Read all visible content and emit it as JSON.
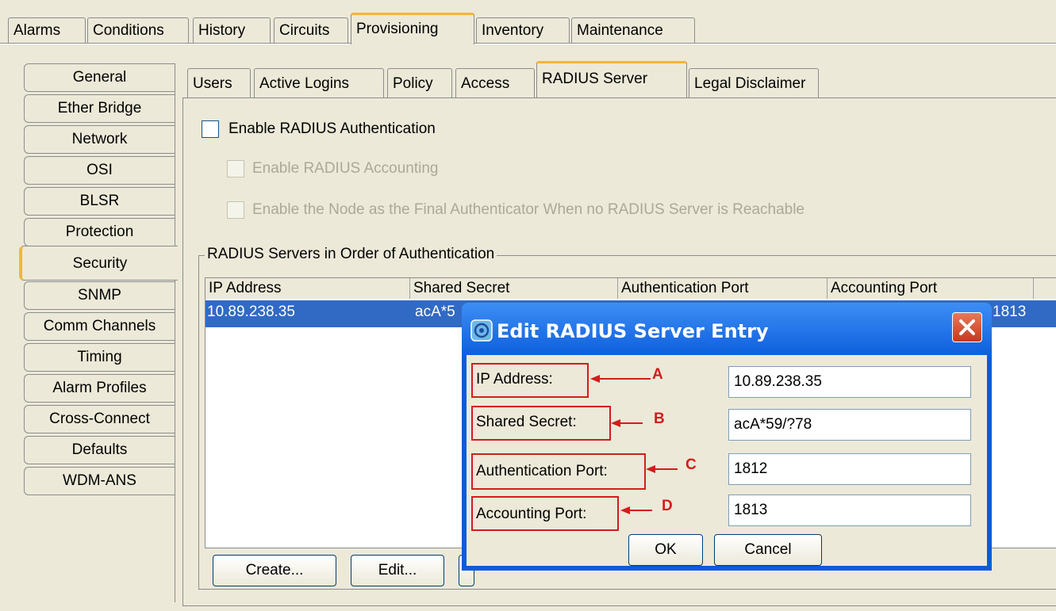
{
  "top_tabs": [
    "Alarms",
    "Conditions",
    "History",
    "Circuits",
    "Provisioning",
    "Inventory",
    "Maintenance"
  ],
  "top_tabs_active": "Provisioning",
  "sidebar": {
    "items": [
      "General",
      "Ether Bridge",
      "Network",
      "OSI",
      "BLSR",
      "Protection",
      "Security",
      "SNMP",
      "Comm Channels",
      "Timing",
      "Alarm Profiles",
      "Cross-Connect",
      "Defaults",
      "WDM-ANS"
    ],
    "active": "Security"
  },
  "sub_tabs": [
    "Users",
    "Active Logins",
    "Policy",
    "Access",
    "RADIUS Server",
    "Legal Disclaimer"
  ],
  "sub_tabs_active": "RADIUS Server",
  "options": {
    "enable_radius_auth": "Enable RADIUS Authentication",
    "enable_radius_accounting": "Enable RADIUS Accounting",
    "enable_final_authenticator": "Enable the Node as the Final Authenticator When no RADIUS Server is Reachable"
  },
  "servers_group": {
    "title": "RADIUS Servers in Order of Authentication",
    "columns": [
      "IP Address",
      "Shared Secret",
      "Authentication Port",
      "Accounting Port"
    ],
    "rows": [
      {
        "ip": "10.89.238.35",
        "secret": "acA*5",
        "auth_port": "",
        "acct_port": "1813"
      }
    ]
  },
  "buttons": {
    "create": "Create...",
    "edit": "Edit..."
  },
  "dialog": {
    "title": "Edit RADIUS Server Entry",
    "fields": [
      {
        "label": "IP Address:",
        "value": "10.89.238.35",
        "marker": "A"
      },
      {
        "label": "Shared Secret:",
        "value": "acA*59/?78",
        "marker": "B"
      },
      {
        "label": "Authentication Port:",
        "value": "1812",
        "marker": "C"
      },
      {
        "label": "Accounting Port:",
        "value": "1813",
        "marker": "D"
      }
    ],
    "ok": "OK",
    "cancel": "Cancel",
    "annotation_color": "#d41c1c"
  },
  "colors": {
    "accent_tab": "#f7b436",
    "selection": "#316ac5",
    "titlebar": "#0a5bdb"
  }
}
